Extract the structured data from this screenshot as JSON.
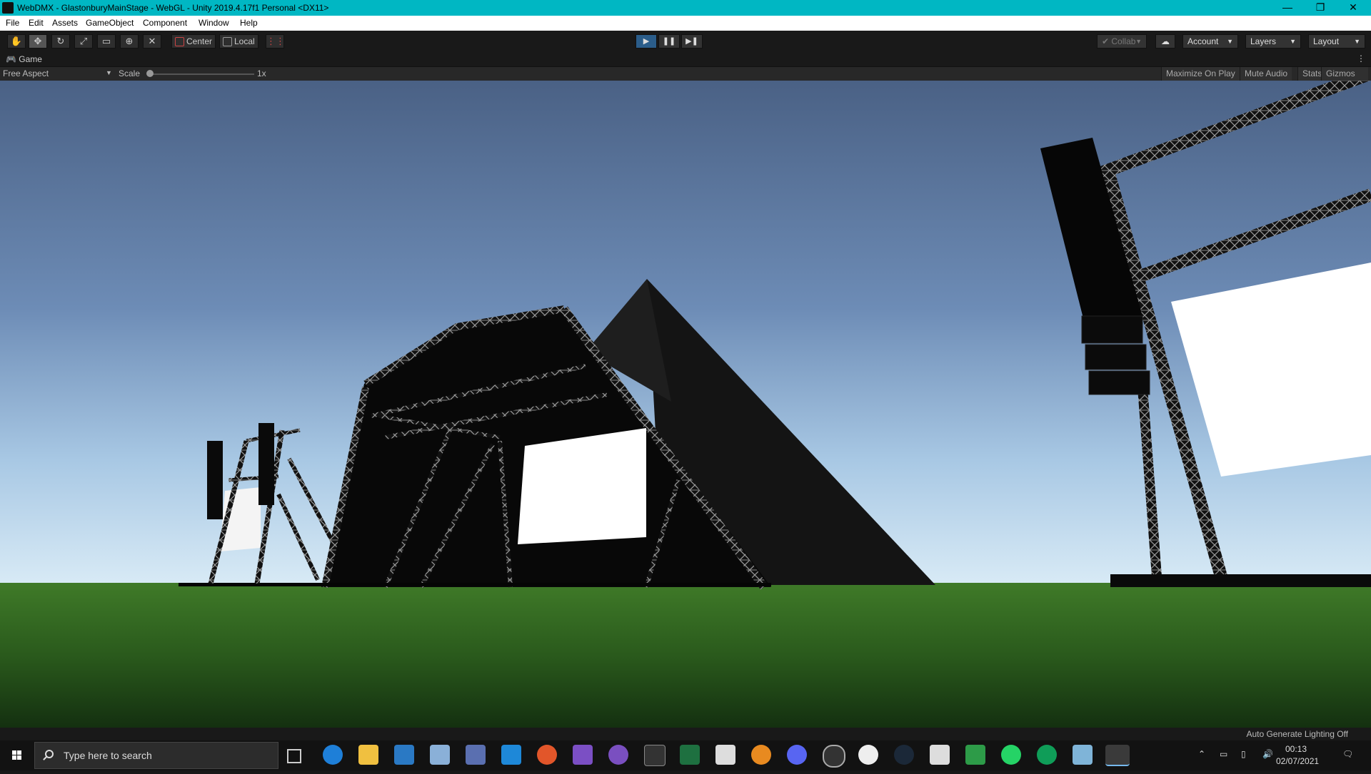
{
  "window": {
    "title": "WebDMX - GlastonburyMainStage - WebGL - Unity 2019.4.17f1 Personal <DX11>",
    "controls": {
      "minimize": "—",
      "restore": "❐",
      "close": "✕"
    }
  },
  "menu": [
    "File",
    "Edit",
    "Assets",
    "GameObject",
    "Component",
    "Window",
    "Help"
  ],
  "toolbar": {
    "tools": [
      "hand-tool",
      "move-tool",
      "rotate-tool",
      "scale-tool",
      "rect-tool",
      "transform-tool",
      "custom-tool"
    ],
    "pivot_mode": "Center",
    "pivot_rotation": "Local",
    "collab": "Collab",
    "account": "Account",
    "layers": "Layers",
    "layout": "Layout"
  },
  "game_view": {
    "tab": "Game",
    "aspect": "Free Aspect",
    "scale_label": "Scale",
    "scale_value": "1x",
    "buttons": [
      "Maximize On Play",
      "Mute Audio",
      "Stats",
      "Gizmos"
    ]
  },
  "status": {
    "lighting": "Auto Generate Lighting Off"
  },
  "taskbar": {
    "search_placeholder": "Type here to search",
    "time": "00:13",
    "date": "02/07/2021"
  },
  "colors": {
    "titlebar": "#00b7c3",
    "play_active": "#2b5d8a",
    "sky_top": "#4a6185",
    "sky_horizon": "#c9e1f2",
    "grass": "#2a5a1c"
  }
}
